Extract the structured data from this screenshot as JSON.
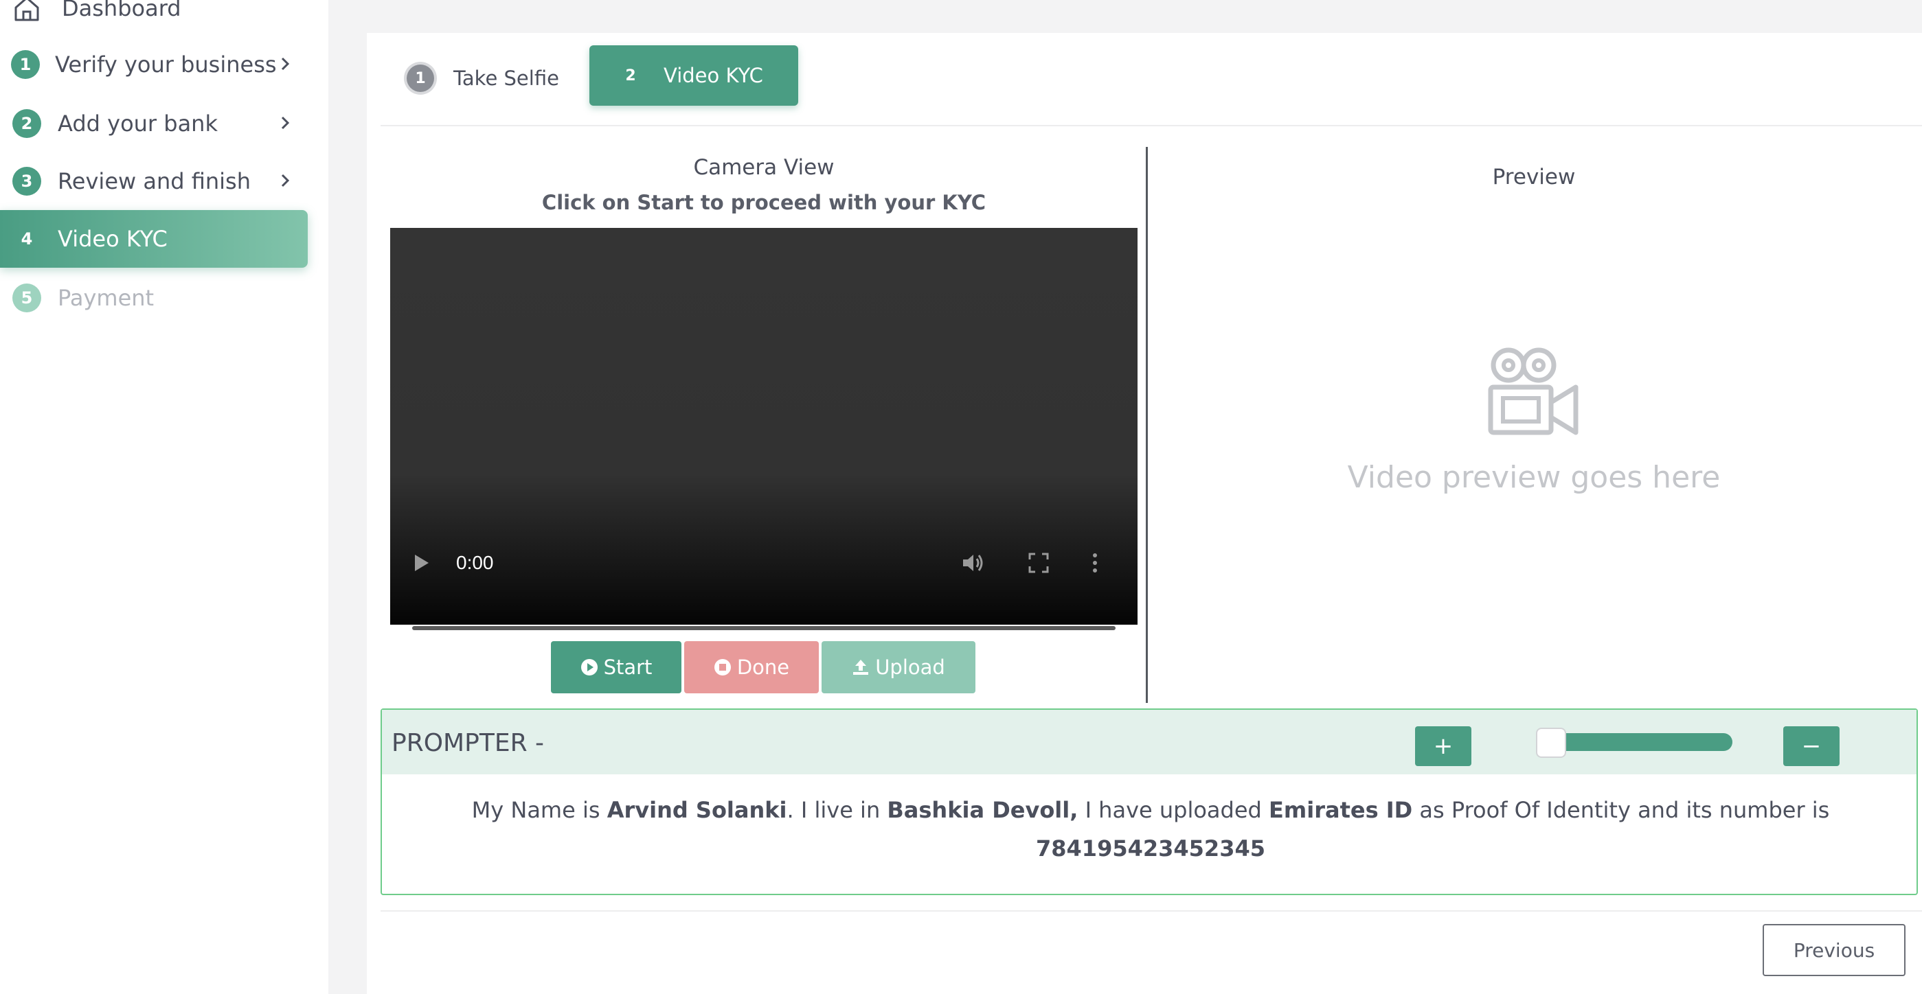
{
  "sidebar": {
    "dashboard_label": "Dashboard",
    "items": [
      {
        "number": "1",
        "label": "Verify your business"
      },
      {
        "number": "2",
        "label": "Add your bank"
      },
      {
        "number": "3",
        "label": "Review and finish"
      },
      {
        "number": "4",
        "label": "Video KYC"
      },
      {
        "number": "5",
        "label": "Payment"
      }
    ]
  },
  "tabs": [
    {
      "number": "1",
      "label": "Take Selfie"
    },
    {
      "number": "2",
      "label": "Video KYC"
    }
  ],
  "camera": {
    "title": "Camera View",
    "subtitle": "Click on Start to proceed with your KYC",
    "time": "0:00"
  },
  "buttons": {
    "start": "Start",
    "done": "Done",
    "upload": "Upload",
    "previous": "Previous"
  },
  "preview": {
    "title": "Preview",
    "placeholder": "Video preview goes here"
  },
  "prompter": {
    "title": "PROMPTER -",
    "plus": "+",
    "minus": "−",
    "speed_fraction": 0.05,
    "t1": "My Name is ",
    "name": "Arvind Solanki",
    "t2": ". I live in ",
    "place": "Bashkia Devoll,",
    "t3": " I have uploaded ",
    "doc": "Emirates ID",
    "t4": " as Proof Of Identity and its number is",
    "number": "784195423452345"
  },
  "colors": {
    "accent": "#4a9d83",
    "done": "#e89a9a",
    "upload": "#8fc8b4",
    "prompter_border": "#6fcc8b",
    "prompter_header": "#e3f1eb"
  }
}
